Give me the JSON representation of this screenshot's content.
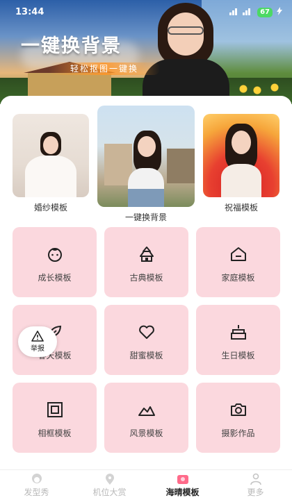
{
  "status_bar": {
    "time": "13:44",
    "signal": "раи раи",
    "battery": "67"
  },
  "banner": {
    "title": "一键换背景",
    "subtitle": "轻松抠图一键换"
  },
  "featured": [
    {
      "label": "婚纱模板"
    },
    {
      "label": "一键换背景"
    },
    {
      "label": "祝福模板"
    }
  ],
  "tiles": [
    {
      "label": "成长模板",
      "icon": "baby-face-icon"
    },
    {
      "label": "古典模板",
      "icon": "pagoda-icon"
    },
    {
      "label": "家庭模板",
      "icon": "house-icon"
    },
    {
      "label": "春天模板",
      "icon": "leaf-icon"
    },
    {
      "label": "甜蜜模板",
      "icon": "heart-icon"
    },
    {
      "label": "生日模板",
      "icon": "cake-icon"
    },
    {
      "label": "相框模板",
      "icon": "frame-icon"
    },
    {
      "label": "风景模板",
      "icon": "mountain-icon"
    },
    {
      "label": "摄影作品",
      "icon": "camera-icon"
    }
  ],
  "report": {
    "label": "举报"
  },
  "tabbar": [
    {
      "label": "发型秀",
      "icon": "hairstyle-icon",
      "active": false
    },
    {
      "label": "机位大赏",
      "icon": "location-icon",
      "active": false
    },
    {
      "label": "海晴模板",
      "icon": "template-icon",
      "active": true
    },
    {
      "label": "更多",
      "icon": "user-icon",
      "active": false
    }
  ],
  "colors": {
    "tile_bg": "#fbd8de",
    "active_tab": "#ff6b8a",
    "inactive_tab": "#b9b9b9"
  }
}
